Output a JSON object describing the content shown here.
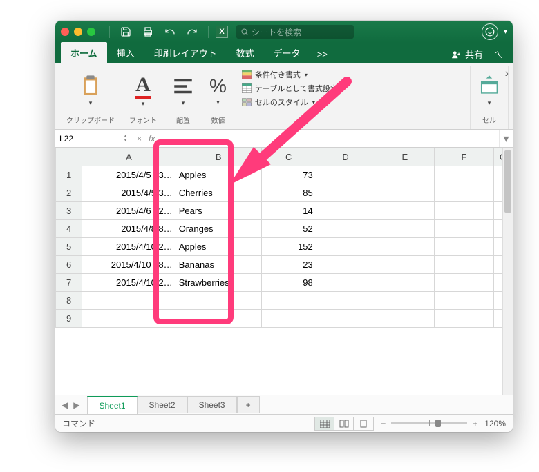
{
  "search": {
    "placeholder": "シートを検索"
  },
  "tabs": {
    "home": "ホーム",
    "insert": "挿入",
    "layout": "印刷レイアウト",
    "formulas": "数式",
    "data": "データ",
    "more": ">>",
    "share": "共有"
  },
  "ribbon": {
    "clipboard": "クリップボード",
    "font": "フォント",
    "align": "配置",
    "number": "数値",
    "cond1": "条件付き書式",
    "cond2": "テーブルとして書式設定",
    "cond3": "セルのスタイル",
    "cells": "セル",
    "font_letter": "A",
    "pct": "%"
  },
  "namebox": {
    "ref": "L22"
  },
  "fx": {
    "times": "×",
    "fx": "fx"
  },
  "cols": {
    "A": "A",
    "B": "B",
    "C": "C",
    "D": "D",
    "E": "E",
    "F": "F",
    "G": "G"
  },
  "rows": {
    "1": {
      "n": "1",
      "A": "2015/4/5 13…",
      "B": "Apples",
      "C": "73"
    },
    "2": {
      "n": "2",
      "A": "2015/4/5 3…",
      "B": "Cherries",
      "C": "85"
    },
    "3": {
      "n": "3",
      "A": "2015/4/6 12…",
      "B": "Pears",
      "C": "14"
    },
    "4": {
      "n": "4",
      "A": "2015/4/8 8…",
      "B": "Oranges",
      "C": "52"
    },
    "5": {
      "n": "5",
      "A": "2015/4/10 2…",
      "B": "Apples",
      "C": "152"
    },
    "6": {
      "n": "6",
      "A": "2015/4/10 18…",
      "B": "Bananas",
      "C": "23"
    },
    "7": {
      "n": "7",
      "A": "2015/4/10 2…",
      "B": "Strawberries",
      "C": "98"
    },
    "8": {
      "n": "8"
    },
    "9": {
      "n": "9"
    }
  },
  "sheets": {
    "s1": "Sheet1",
    "s2": "Sheet2",
    "s3": "Sheet3",
    "add": "+"
  },
  "status": {
    "mode": "コマンド",
    "minus": "−",
    "plus": "+",
    "zoom": "120%"
  }
}
